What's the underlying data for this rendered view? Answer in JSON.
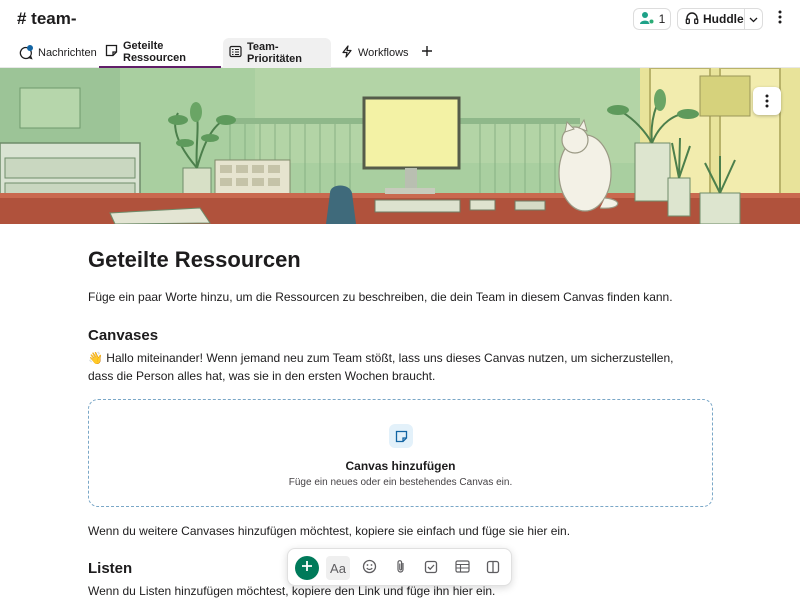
{
  "header": {
    "channel_title": "# team-",
    "member_count": "1",
    "huddle_label": "Huddle"
  },
  "tabs": [
    {
      "label": "Nachrichten",
      "icon": "message-icon",
      "state": "normal"
    },
    {
      "label": "Geteilte Ressourcen",
      "icon": "canvas-icon",
      "state": "active"
    },
    {
      "label": "Team-Prioritäten",
      "icon": "list-icon",
      "state": "hover"
    },
    {
      "label": "Workflows",
      "icon": "lightning-icon",
      "state": "normal"
    }
  ],
  "document": {
    "title": "Geteilte Ressourcen",
    "description": "Füge ein paar Worte hinzu, um die Ressourcen zu beschreiben, die dein Team in diesem Canvas finden kann.",
    "canvases_heading": "Canvases",
    "intro_emoji": "👋",
    "intro_text": "Hallo miteinander! Wenn jemand neu zum Team stößt, lass uns dieses Canvas nutzen, um sicherzustellen, dass die Person alles hat, was sie in den ersten Wochen braucht.",
    "add_canvas_title": "Canvas hinzufügen",
    "add_canvas_subtitle": "Füge ein neues oder ein bestehendes Canvas ein.",
    "more_canvases_text": "Wenn du weitere Canvases hinzufügen möchtest, kopiere sie einfach und füge sie hier ein.",
    "lists_heading": "Listen",
    "lists_text": "Wenn du Listen hinzufügen möchtest, kopiere den Link und füge ihn hier ein."
  },
  "toolbar": {
    "format_label": "Aa",
    "buttons": [
      "add-icon",
      "text-format-icon",
      "emoji-icon",
      "attachment-icon",
      "checklist-icon",
      "table-icon",
      "columns-icon"
    ]
  },
  "colors": {
    "accent_purple": "#611f69",
    "add_green": "#007a5a",
    "banner_green": "#9cc49a",
    "dashed_border": "#7aa7c7"
  }
}
